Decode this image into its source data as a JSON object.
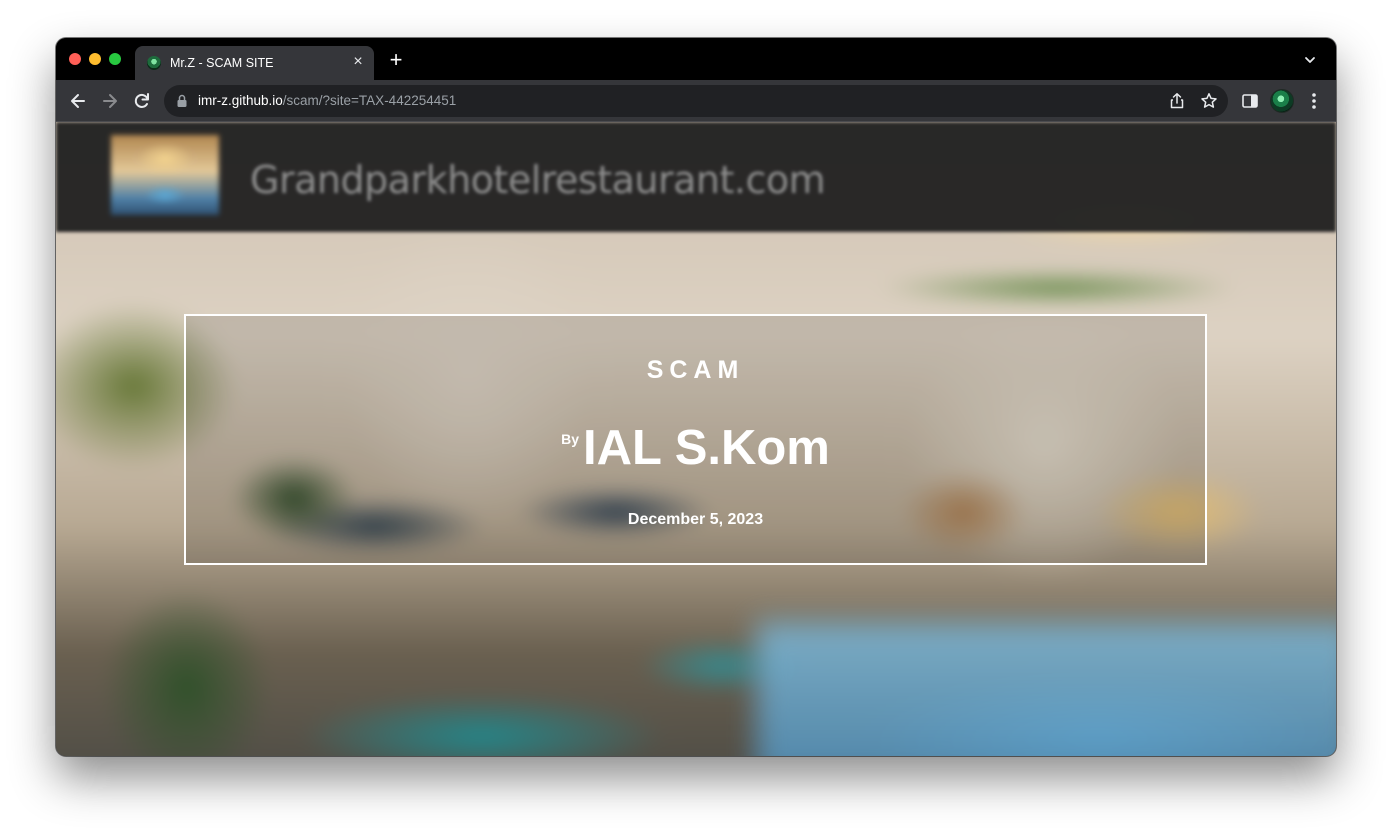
{
  "browser": {
    "tab": {
      "title": "Mr.Z - SCAM SITE",
      "favicon": "mrz-favicon"
    },
    "new_tab_label": "+",
    "close_tab_label": "×",
    "url": {
      "host": "imr-z.github.io",
      "path": "/scam/?site=TAX-442254451"
    },
    "icons": {
      "back": "arrow-left-icon",
      "forward": "arrow-right-icon",
      "reload": "reload-icon",
      "lock": "lock-icon",
      "share": "share-icon",
      "bookmark": "star-icon",
      "side_panel": "side-panel-icon",
      "menu": "kebab-menu-icon",
      "tab_list": "chevron-down-icon"
    }
  },
  "site": {
    "header": {
      "title": "Grandparkhotelrestaurant.com"
    },
    "hero": {
      "kicker": "SCAM",
      "by_prefix": "By",
      "author": "IAL S.Kom",
      "date": "December 5, 2023"
    }
  },
  "colors": {
    "tab_strip": "#000000",
    "toolbar": "#35363a",
    "omnibox": "#202124",
    "hero_border": "#ffffff",
    "header_bg": "#212121"
  }
}
